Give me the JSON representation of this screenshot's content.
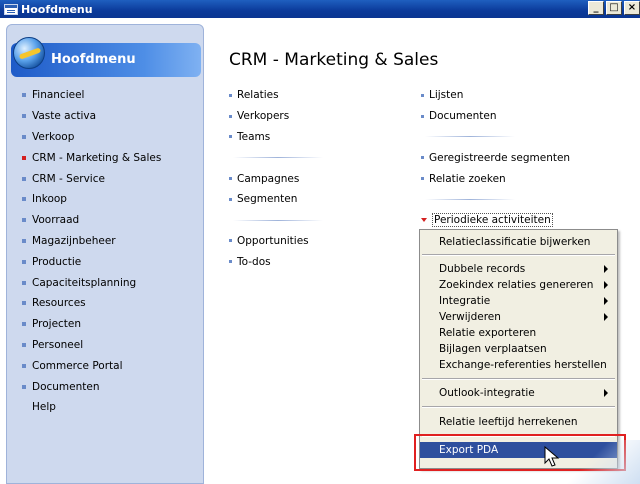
{
  "window": {
    "title": "Hoofdmenu",
    "controls": [
      "_",
      "□",
      "×"
    ]
  },
  "sidebar": {
    "title": "Hoofdmenu",
    "items": [
      {
        "label": "Financieel"
      },
      {
        "label": "Vaste activa"
      },
      {
        "label": "Verkoop"
      },
      {
        "label": "CRM - Marketing & Sales",
        "active": true
      },
      {
        "label": "CRM - Service"
      },
      {
        "label": "Inkoop"
      },
      {
        "label": "Voorraad"
      },
      {
        "label": "Magazijnbeheer"
      },
      {
        "label": "Productie"
      },
      {
        "label": "Capaciteitsplanning"
      },
      {
        "label": "Resources"
      },
      {
        "label": "Projecten"
      },
      {
        "label": "Personeel"
      },
      {
        "label": "Commerce Portal"
      },
      {
        "label": "Documenten"
      },
      {
        "label": "Help"
      }
    ]
  },
  "main": {
    "title": "CRM - Marketing & Sales",
    "col1": {
      "relaties": "Relaties",
      "verkopers": "Verkopers",
      "teams": "Teams",
      "campagnes": "Campagnes",
      "segmenten": "Segmenten",
      "opportunities": "Opportunities",
      "todos": "To-dos"
    },
    "col2": {
      "lijsten": "Lijsten",
      "documenten": "Documenten",
      "geregistreerde": "Geregistreerde segmenten",
      "relatie_zoeken": "Relatie zoeken",
      "periodieke": "Periodieke activiteiten"
    }
  },
  "context_menu": {
    "items": [
      "Relatieclassificatie bijwerken",
      "Dubbele records",
      "Zoekindex relaties genereren",
      "Integratie",
      "Verwijderen",
      "Relatie exporteren",
      "Bijlagen verplaatsen",
      "Exchange-referenties herstellen",
      "Outlook-integratie",
      "Relatie leeftijd herrekenen",
      "Export PDA"
    ],
    "selected": "Export PDA"
  }
}
